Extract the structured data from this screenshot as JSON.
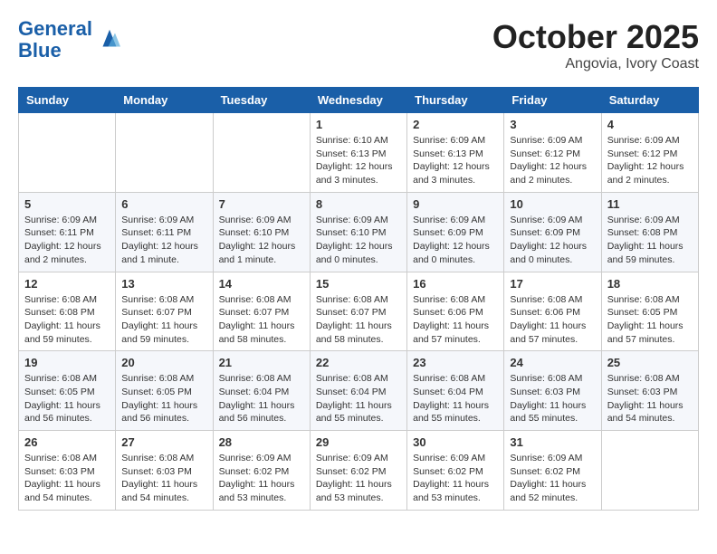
{
  "header": {
    "logo_line1": "General",
    "logo_line2": "Blue",
    "month": "October 2025",
    "location": "Angovia, Ivory Coast"
  },
  "weekdays": [
    "Sunday",
    "Monday",
    "Tuesday",
    "Wednesday",
    "Thursday",
    "Friday",
    "Saturday"
  ],
  "weeks": [
    [
      {
        "day": "",
        "info": ""
      },
      {
        "day": "",
        "info": ""
      },
      {
        "day": "",
        "info": ""
      },
      {
        "day": "1",
        "info": "Sunrise: 6:10 AM\nSunset: 6:13 PM\nDaylight: 12 hours and 3 minutes."
      },
      {
        "day": "2",
        "info": "Sunrise: 6:09 AM\nSunset: 6:13 PM\nDaylight: 12 hours and 3 minutes."
      },
      {
        "day": "3",
        "info": "Sunrise: 6:09 AM\nSunset: 6:12 PM\nDaylight: 12 hours and 2 minutes."
      },
      {
        "day": "4",
        "info": "Sunrise: 6:09 AM\nSunset: 6:12 PM\nDaylight: 12 hours and 2 minutes."
      }
    ],
    [
      {
        "day": "5",
        "info": "Sunrise: 6:09 AM\nSunset: 6:11 PM\nDaylight: 12 hours and 2 minutes."
      },
      {
        "day": "6",
        "info": "Sunrise: 6:09 AM\nSunset: 6:11 PM\nDaylight: 12 hours and 1 minute."
      },
      {
        "day": "7",
        "info": "Sunrise: 6:09 AM\nSunset: 6:10 PM\nDaylight: 12 hours and 1 minute."
      },
      {
        "day": "8",
        "info": "Sunrise: 6:09 AM\nSunset: 6:10 PM\nDaylight: 12 hours and 0 minutes."
      },
      {
        "day": "9",
        "info": "Sunrise: 6:09 AM\nSunset: 6:09 PM\nDaylight: 12 hours and 0 minutes."
      },
      {
        "day": "10",
        "info": "Sunrise: 6:09 AM\nSunset: 6:09 PM\nDaylight: 12 hours and 0 minutes."
      },
      {
        "day": "11",
        "info": "Sunrise: 6:09 AM\nSunset: 6:08 PM\nDaylight: 11 hours and 59 minutes."
      }
    ],
    [
      {
        "day": "12",
        "info": "Sunrise: 6:08 AM\nSunset: 6:08 PM\nDaylight: 11 hours and 59 minutes."
      },
      {
        "day": "13",
        "info": "Sunrise: 6:08 AM\nSunset: 6:07 PM\nDaylight: 11 hours and 59 minutes."
      },
      {
        "day": "14",
        "info": "Sunrise: 6:08 AM\nSunset: 6:07 PM\nDaylight: 11 hours and 58 minutes."
      },
      {
        "day": "15",
        "info": "Sunrise: 6:08 AM\nSunset: 6:07 PM\nDaylight: 11 hours and 58 minutes."
      },
      {
        "day": "16",
        "info": "Sunrise: 6:08 AM\nSunset: 6:06 PM\nDaylight: 11 hours and 57 minutes."
      },
      {
        "day": "17",
        "info": "Sunrise: 6:08 AM\nSunset: 6:06 PM\nDaylight: 11 hours and 57 minutes."
      },
      {
        "day": "18",
        "info": "Sunrise: 6:08 AM\nSunset: 6:05 PM\nDaylight: 11 hours and 57 minutes."
      }
    ],
    [
      {
        "day": "19",
        "info": "Sunrise: 6:08 AM\nSunset: 6:05 PM\nDaylight: 11 hours and 56 minutes."
      },
      {
        "day": "20",
        "info": "Sunrise: 6:08 AM\nSunset: 6:05 PM\nDaylight: 11 hours and 56 minutes."
      },
      {
        "day": "21",
        "info": "Sunrise: 6:08 AM\nSunset: 6:04 PM\nDaylight: 11 hours and 56 minutes."
      },
      {
        "day": "22",
        "info": "Sunrise: 6:08 AM\nSunset: 6:04 PM\nDaylight: 11 hours and 55 minutes."
      },
      {
        "day": "23",
        "info": "Sunrise: 6:08 AM\nSunset: 6:04 PM\nDaylight: 11 hours and 55 minutes."
      },
      {
        "day": "24",
        "info": "Sunrise: 6:08 AM\nSunset: 6:03 PM\nDaylight: 11 hours and 55 minutes."
      },
      {
        "day": "25",
        "info": "Sunrise: 6:08 AM\nSunset: 6:03 PM\nDaylight: 11 hours and 54 minutes."
      }
    ],
    [
      {
        "day": "26",
        "info": "Sunrise: 6:08 AM\nSunset: 6:03 PM\nDaylight: 11 hours and 54 minutes."
      },
      {
        "day": "27",
        "info": "Sunrise: 6:08 AM\nSunset: 6:03 PM\nDaylight: 11 hours and 54 minutes."
      },
      {
        "day": "28",
        "info": "Sunrise: 6:09 AM\nSunset: 6:02 PM\nDaylight: 11 hours and 53 minutes."
      },
      {
        "day": "29",
        "info": "Sunrise: 6:09 AM\nSunset: 6:02 PM\nDaylight: 11 hours and 53 minutes."
      },
      {
        "day": "30",
        "info": "Sunrise: 6:09 AM\nSunset: 6:02 PM\nDaylight: 11 hours and 53 minutes."
      },
      {
        "day": "31",
        "info": "Sunrise: 6:09 AM\nSunset: 6:02 PM\nDaylight: 11 hours and 52 minutes."
      },
      {
        "day": "",
        "info": ""
      }
    ]
  ]
}
